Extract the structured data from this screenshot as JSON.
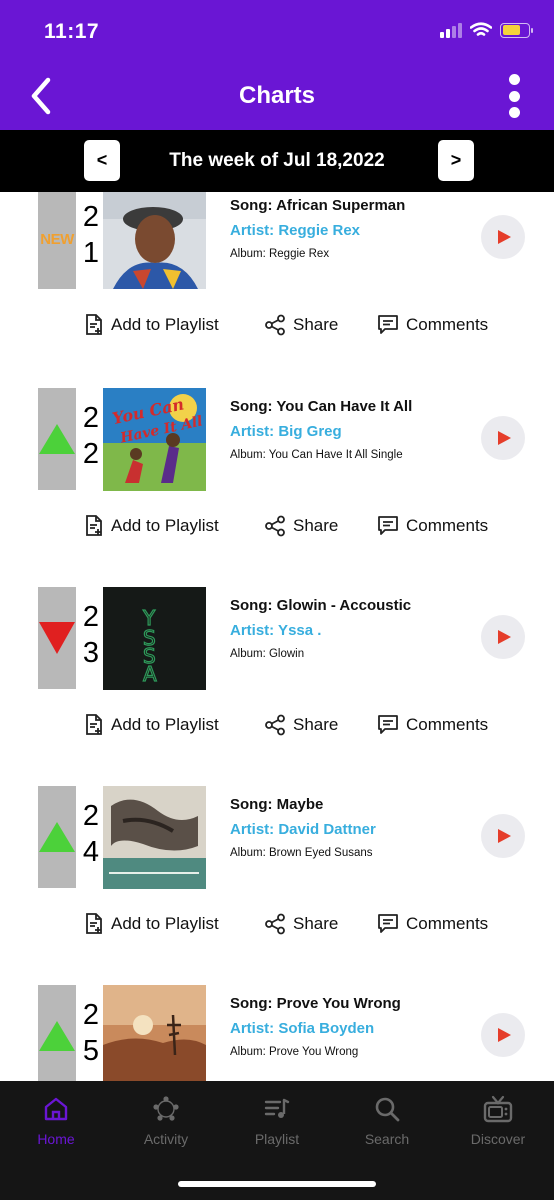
{
  "status_bar": {
    "time": "11:17",
    "signal_icon": "cellular-signal-icon",
    "wifi_icon": "wifi-icon",
    "battery_icon": "battery-icon",
    "battery_color": "#f5d33a"
  },
  "header": {
    "title": "Charts",
    "back_icon": "chevron-left-icon",
    "menu_icon": "vertical-ellipsis-icon",
    "background": "#6a16d4"
  },
  "week_nav": {
    "prev_label": "<",
    "next_label": ">",
    "label": "The week of Jul 18,2022"
  },
  "colors": {
    "artist": "#38aede",
    "up": "#4cd13a",
    "down": "#e02020",
    "new": "#f0a030",
    "play": "#e53d2a"
  },
  "entries": [
    {
      "rank_digits": [
        "2",
        "1"
      ],
      "movement": "new",
      "movement_label": "NEW",
      "song": "Song: African Superman",
      "artist": "Artist: Reggie Rex",
      "album": "Album: Reggie Rex"
    },
    {
      "rank_digits": [
        "2",
        "2"
      ],
      "movement": "up",
      "song": "Song: You Can Have It All",
      "artist": "Artist: Big Greg",
      "album": "Album: You Can Have It All Single"
    },
    {
      "rank_digits": [
        "2",
        "3"
      ],
      "movement": "down",
      "song": "Song: Glowin - Accoustic",
      "artist": "Artist: Yssa .",
      "album": "Album: Glowin"
    },
    {
      "rank_digits": [
        "2",
        "4"
      ],
      "movement": "up",
      "song": "Song: Maybe",
      "artist": "Artist: David Dattner",
      "album": "Album: Brown Eyed Susans"
    },
    {
      "rank_digits": [
        "2",
        "5"
      ],
      "movement": "up",
      "song": "Song: Prove You Wrong",
      "artist": "Artist: Sofia Boyden",
      "album": "Album: Prove You Wrong"
    }
  ],
  "actions": {
    "add_to_playlist": "Add to Playlist",
    "share": "Share",
    "comments": "Comments"
  },
  "tabs": [
    {
      "label": "Home",
      "icon": "home-icon",
      "active": true
    },
    {
      "label": "Activity",
      "icon": "activity-icon",
      "active": false
    },
    {
      "label": "Playlist",
      "icon": "playlist-icon",
      "active": false
    },
    {
      "label": "Search",
      "icon": "search-icon",
      "active": false
    },
    {
      "label": "Discover",
      "icon": "tv-icon",
      "active": false
    }
  ]
}
